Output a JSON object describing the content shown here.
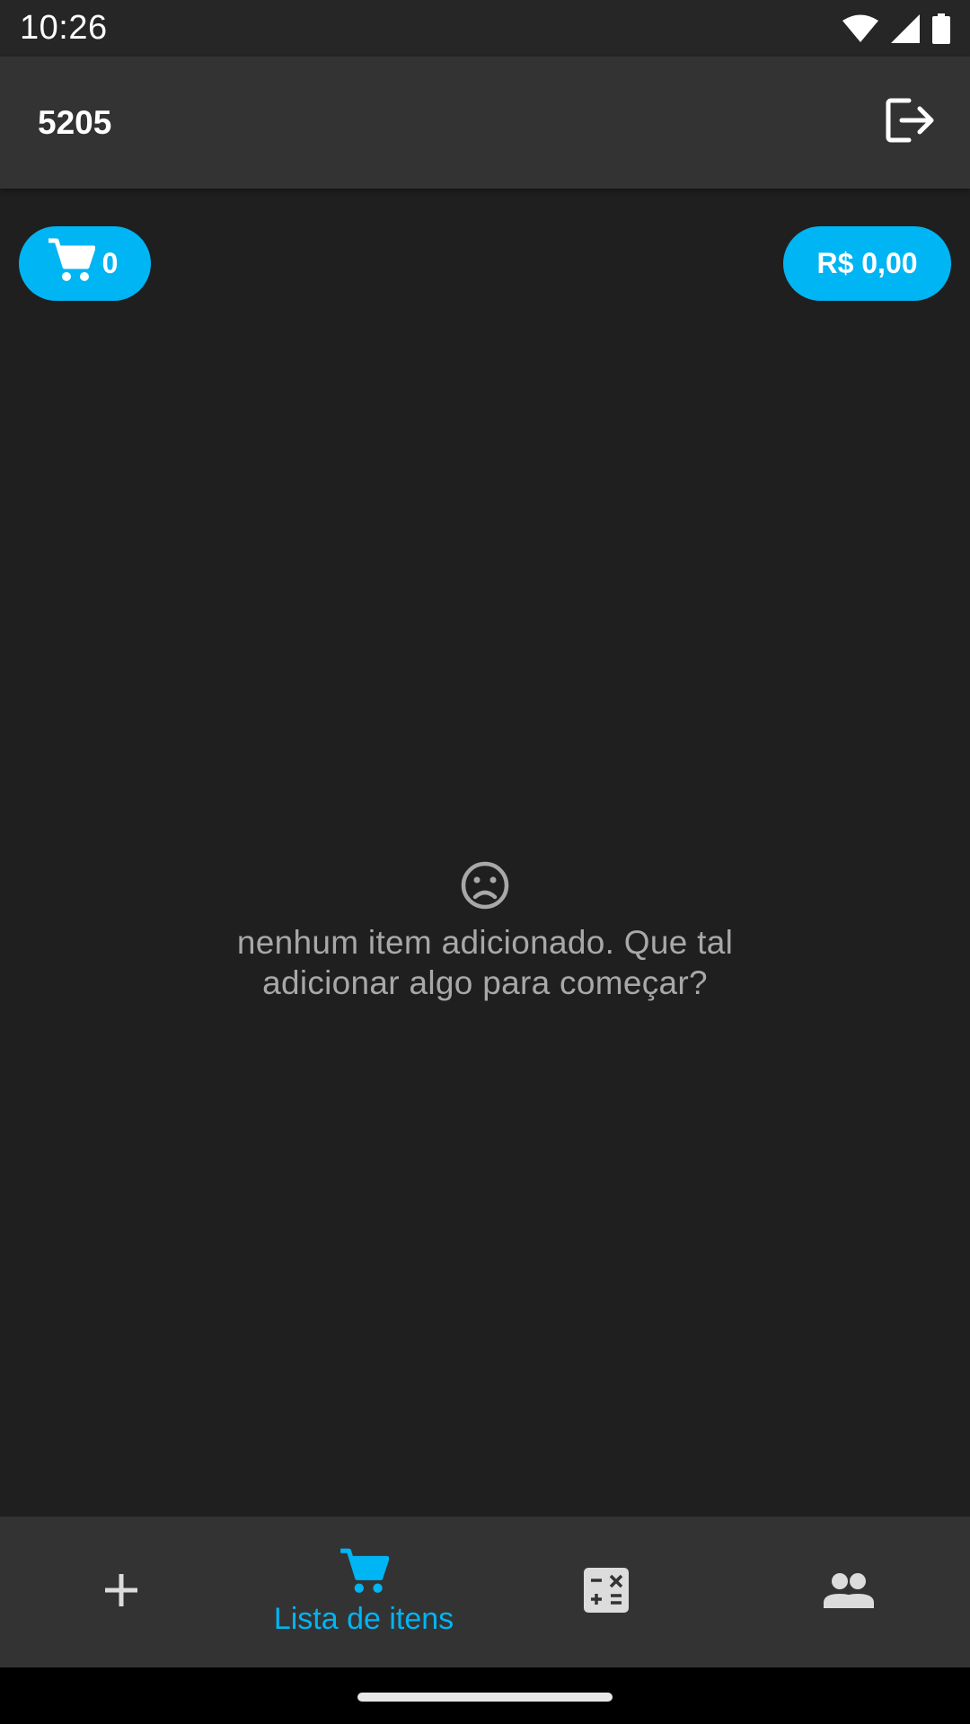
{
  "status_bar": {
    "time": "10:26",
    "icons": [
      "wifi-icon",
      "signal-icon",
      "battery-icon"
    ]
  },
  "app_bar": {
    "title": "5205",
    "logout_icon": "logout-icon"
  },
  "summary": {
    "cart_count": "0",
    "total": "R$ 0,00",
    "accent_color": "#00b5f3"
  },
  "empty_state": {
    "icon": "sad-face-icon",
    "message": "nenhum item adicionado. Que tal adicionar algo para começar?"
  },
  "bottom_nav": {
    "items": [
      {
        "icon": "plus-icon",
        "label": "",
        "active": false
      },
      {
        "icon": "cart-icon",
        "label": "Lista de itens",
        "active": true
      },
      {
        "icon": "calculator-icon",
        "label": "",
        "active": false
      },
      {
        "icon": "people-icon",
        "label": "",
        "active": false
      }
    ]
  }
}
